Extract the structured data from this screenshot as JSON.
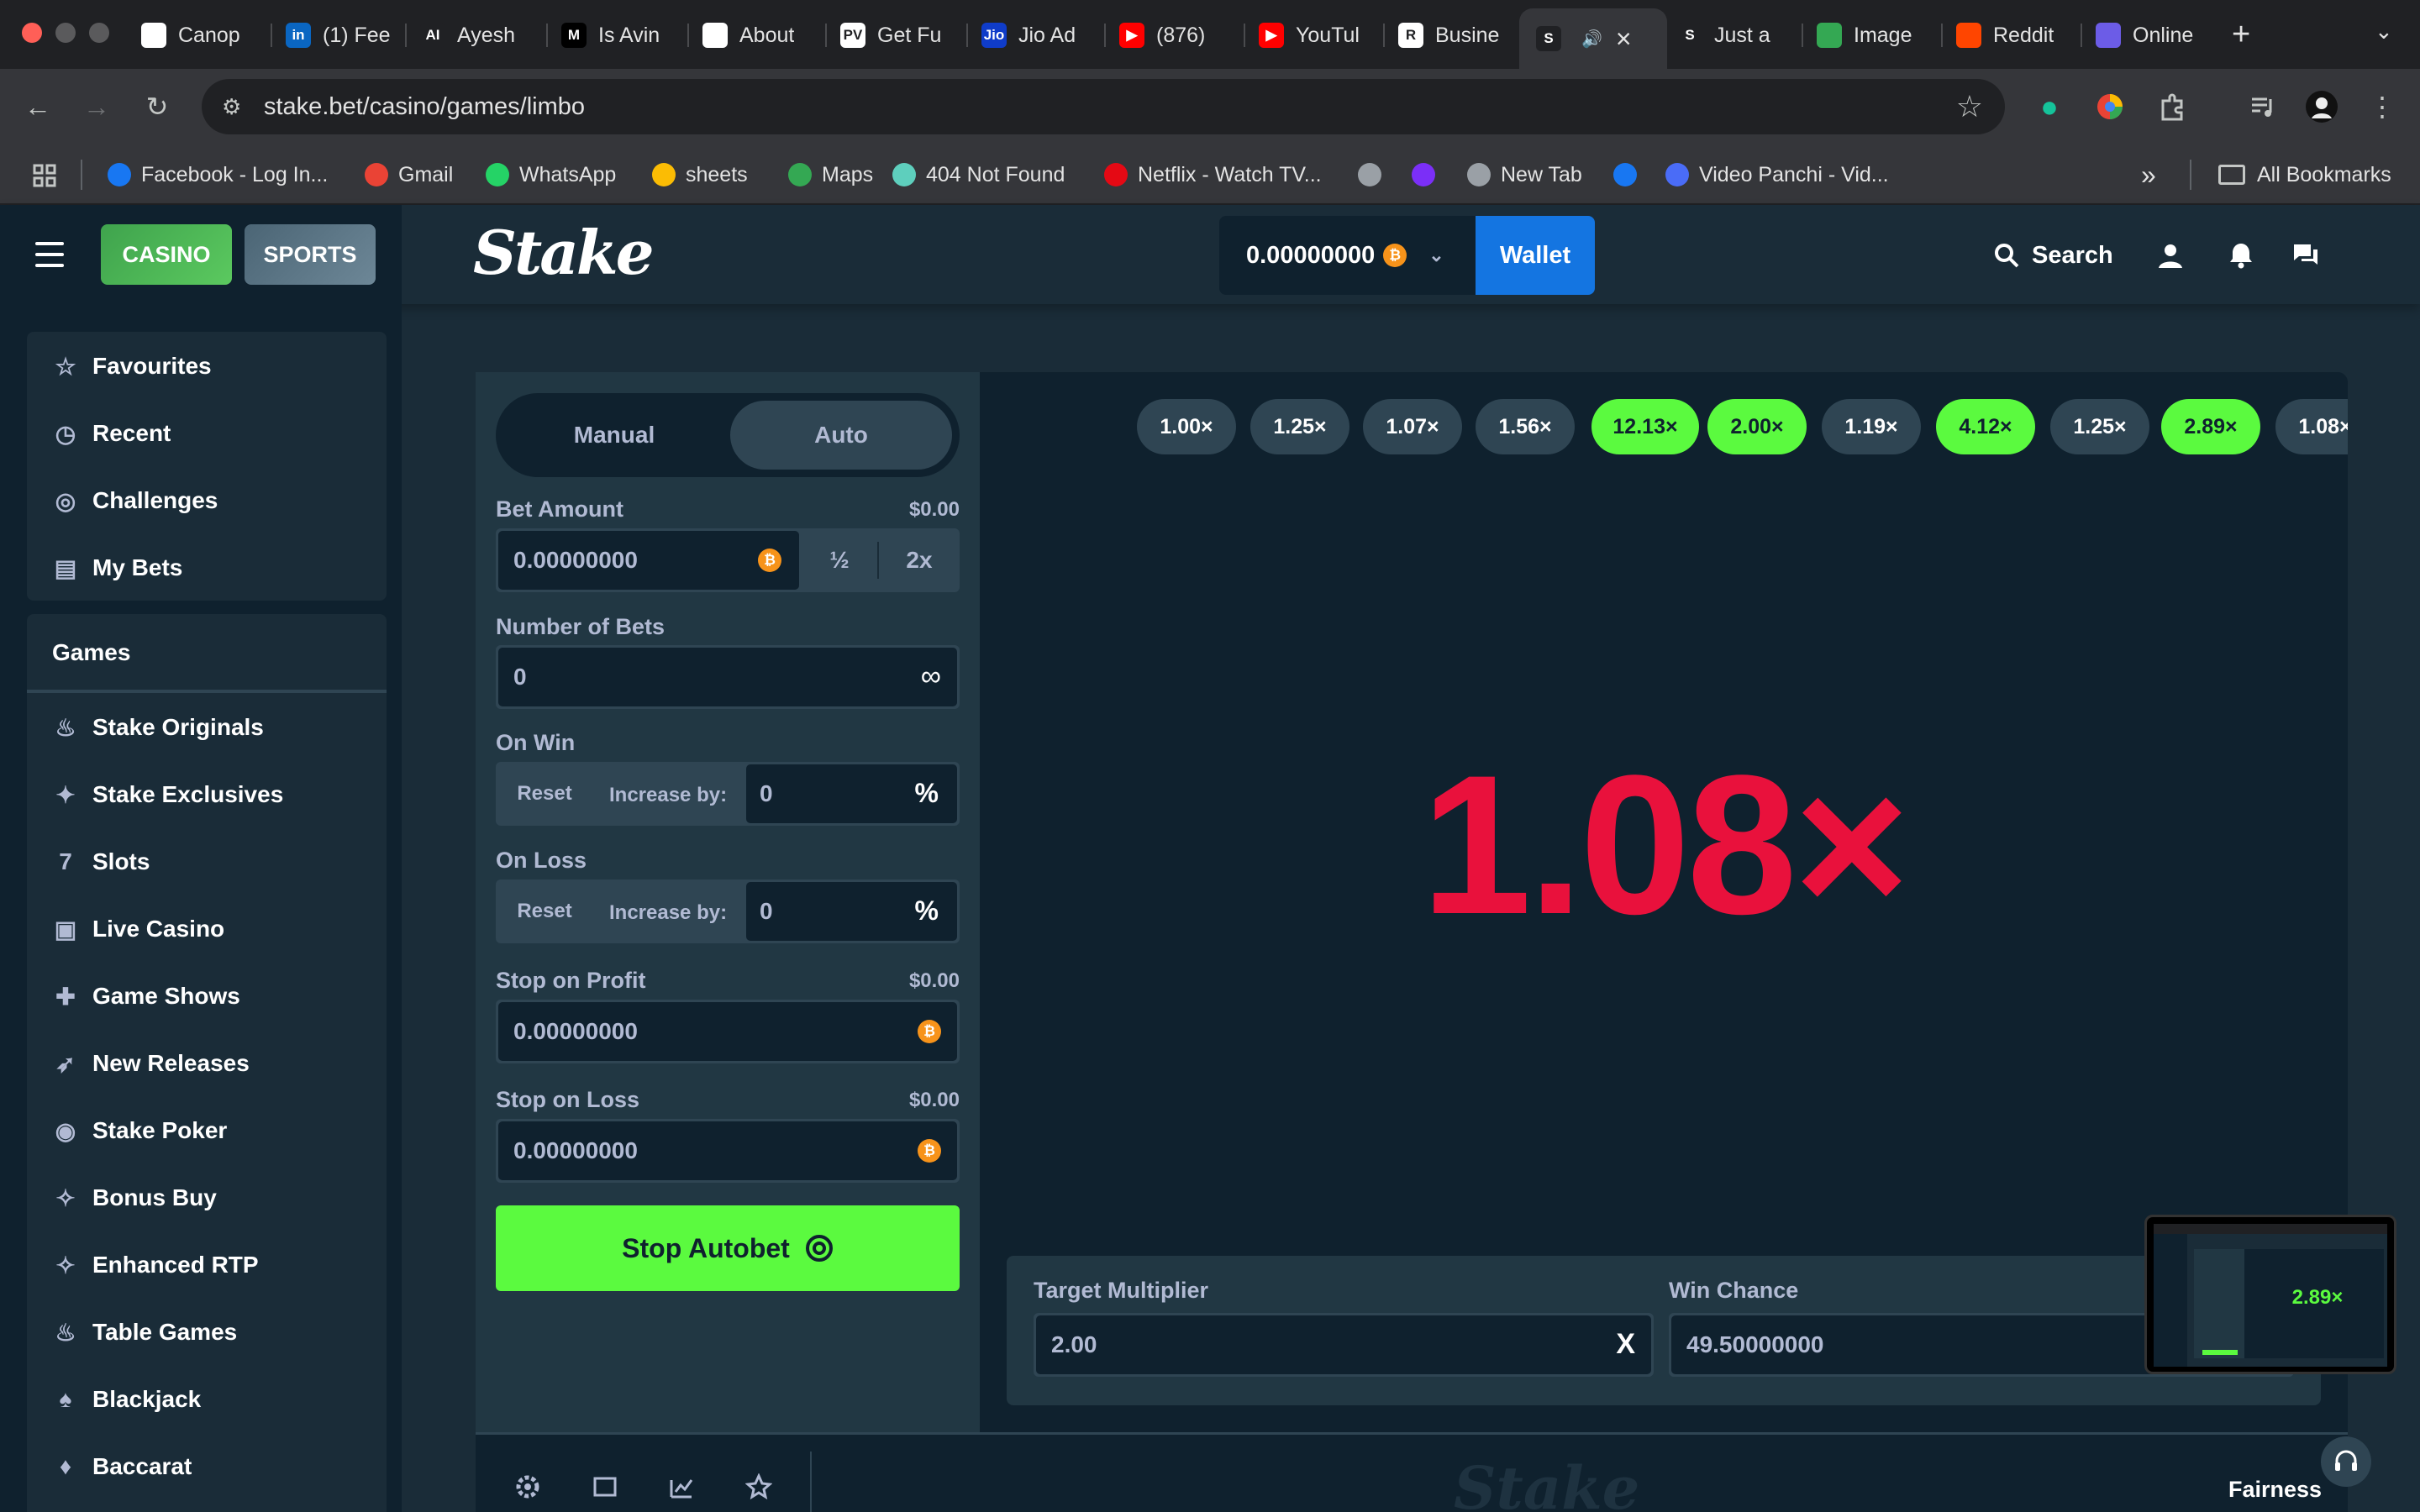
{
  "browser": {
    "tabs": [
      {
        "title": "Canop",
        "fav_color": "#ffffff",
        "fav_text": "",
        "active": false
      },
      {
        "title": "(1) Fee",
        "fav_color": "#0a66c2",
        "fav_text": "in",
        "active": false
      },
      {
        "title": "Ayesh",
        "fav_color": "#202124",
        "fav_text": "AI",
        "active": false
      },
      {
        "title": "Is Avin",
        "fav_color": "#000000",
        "fav_text": "M",
        "active": false
      },
      {
        "title": "About",
        "fav_color": "#ffffff",
        "fav_text": "",
        "active": false
      },
      {
        "title": "Get Fu",
        "fav_color": "#ffffff",
        "fav_text": "PV",
        "active": false
      },
      {
        "title": "Jio Ad",
        "fav_color": "#0f3cc9",
        "fav_text": "Jio",
        "active": false
      },
      {
        "title": "(876)",
        "fav_color": "#ff0000",
        "fav_text": "▶",
        "active": false
      },
      {
        "title": "YouTul",
        "fav_color": "#ff0000",
        "fav_text": "▶",
        "active": false
      },
      {
        "title": "Busine",
        "fav_color": "#ffffff",
        "fav_text": "R",
        "active": false
      },
      {
        "title": "",
        "fav_color": "#202124",
        "fav_text": "S",
        "active": true
      },
      {
        "title": "Just a",
        "fav_color": "#202124",
        "fav_text": "S",
        "active": false
      },
      {
        "title": "Image",
        "fav_color": "#34a853",
        "fav_text": "",
        "active": false
      },
      {
        "title": "Reddit",
        "fav_color": "#ff4500",
        "fav_text": "",
        "active": false
      },
      {
        "title": "Online",
        "fav_color": "#6c5ce7",
        "fav_text": "",
        "active": false
      }
    ],
    "url": "stake.bet/casino/games/limbo",
    "bookmarks": [
      {
        "label": "Facebook - Log In...",
        "color": "#1877f2"
      },
      {
        "label": "Gmail",
        "color": "#ea4335"
      },
      {
        "label": "WhatsApp",
        "color": "#25d366"
      },
      {
        "label": "sheets",
        "color": "#fbbc04"
      },
      {
        "label": "Maps",
        "color": "#34a853"
      },
      {
        "label": "404 Not Found",
        "color": "#5ecfbd"
      },
      {
        "label": "Netflix - Watch TV...",
        "color": "#e50914"
      },
      {
        "label": "",
        "color": "#9aa0a6"
      },
      {
        "label": "",
        "color": "#7b2ff7"
      },
      {
        "label": "New Tab",
        "color": "#9aa0a6"
      },
      {
        "label": "",
        "color": "#1877f2"
      },
      {
        "label": "Video Panchi - Vid...",
        "color": "#4a6cf7"
      }
    ],
    "all_bookmarks": "All Bookmarks",
    "more_bookmarks": "»"
  },
  "header": {
    "casino": "CASINO",
    "sports": "SPORTS",
    "logo": "Stake",
    "balance": "0.00000000",
    "wallet": "Wallet",
    "search": "Search"
  },
  "sidebar": {
    "top_items": [
      {
        "label": "Favourites",
        "icon": "star-icon"
      },
      {
        "label": "Recent",
        "icon": "clock-icon"
      },
      {
        "label": "Challenges",
        "icon": "target-icon"
      },
      {
        "label": "My Bets",
        "icon": "receipt-icon"
      }
    ],
    "games_heading": "Games",
    "game_items": [
      {
        "label": "Stake Originals",
        "icon": "flame-icon"
      },
      {
        "label": "Stake Exclusives",
        "icon": "bookmark-star-icon"
      },
      {
        "label": "Slots",
        "icon": "slots-icon"
      },
      {
        "label": "Live Casino",
        "icon": "live-icon"
      },
      {
        "label": "Game Shows",
        "icon": "gift-icon"
      },
      {
        "label": "New Releases",
        "icon": "rocket-icon"
      },
      {
        "label": "Stake Poker",
        "icon": "chip-icon"
      },
      {
        "label": "Bonus Buy",
        "icon": "bonus-icon"
      },
      {
        "label": "Enhanced RTP",
        "icon": "rtp-icon"
      },
      {
        "label": "Table Games",
        "icon": "table-icon"
      },
      {
        "label": "Blackjack",
        "icon": "cards-icon"
      },
      {
        "label": "Baccarat",
        "icon": "baccarat-icon"
      }
    ]
  },
  "controls": {
    "manual": "Manual",
    "auto": "Auto",
    "bet_amount_label": "Bet Amount",
    "bet_amount_usd": "$0.00",
    "bet_amount": "0.00000000",
    "half": "½",
    "double": "2x",
    "num_bets_label": "Number of Bets",
    "num_bets": "0",
    "on_win_label": "On Win",
    "on_loss_label": "On Loss",
    "reset": "Reset",
    "increase_by": "Increase by:",
    "on_win_value": "0",
    "on_loss_value": "0",
    "percent": "%",
    "stop_profit_label": "Stop on Profit",
    "stop_profit_usd": "$0.00",
    "stop_profit": "0.00000000",
    "stop_loss_label": "Stop on Loss",
    "stop_loss_usd": "$0.00",
    "stop_loss": "0.00000000",
    "stop_autobet": "Stop Autobet"
  },
  "game": {
    "history": [
      {
        "value": "1.00×",
        "win": false
      },
      {
        "value": "1.25×",
        "win": false
      },
      {
        "value": "1.07×",
        "win": false
      },
      {
        "value": "1.56×",
        "win": false
      },
      {
        "value": "12.13×",
        "win": true
      },
      {
        "value": "2.00×",
        "win": true
      },
      {
        "value": "1.19×",
        "win": false
      },
      {
        "value": "4.12×",
        "win": true
      },
      {
        "value": "1.25×",
        "win": false
      },
      {
        "value": "2.89×",
        "win": true
      },
      {
        "value": "1.08×",
        "win": false
      }
    ],
    "result": "1.08×",
    "result_color": "#e9113c",
    "win_color": "#5bfa3f",
    "target_label": "Target Multiplier",
    "target_value": "2.00",
    "win_chance_label": "Win Chance",
    "win_chance": "49.50000000",
    "pip_value": "2.89×",
    "fairness": "Fairness",
    "footer_logo": "Stake"
  }
}
